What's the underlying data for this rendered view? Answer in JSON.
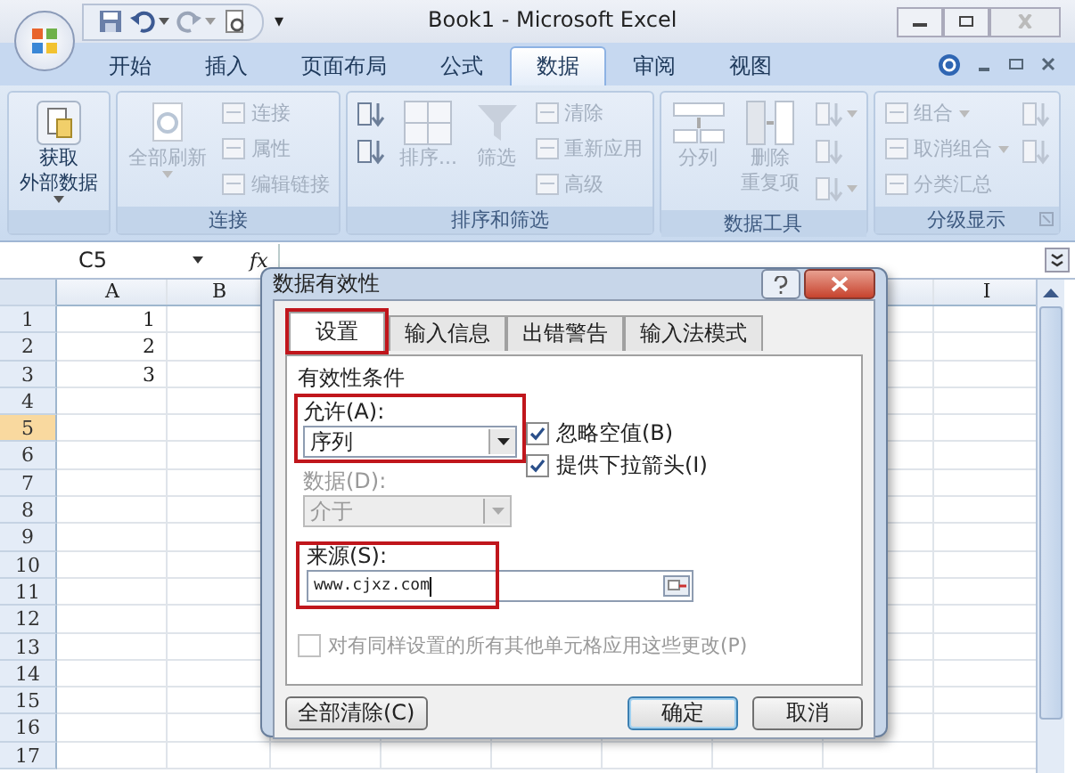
{
  "window": {
    "title": "Book1 - Microsoft Excel",
    "customize_glyph": "▾"
  },
  "ribbon_tabs": [
    {
      "label": "开始",
      "selected": false
    },
    {
      "label": "插入",
      "selected": false
    },
    {
      "label": "页面布局",
      "selected": false
    },
    {
      "label": "公式",
      "selected": false
    },
    {
      "label": "数据",
      "selected": true
    },
    {
      "label": "审阅",
      "selected": false
    },
    {
      "label": "视图",
      "selected": false
    }
  ],
  "ribbon_groups": [
    {
      "columns": [
        [
          {
            "kind": "large",
            "lines": [
              "获取",
              "外部数据"
            ],
            "dropdown": true,
            "disabled": false
          }
        ]
      ]
    },
    {
      "label": "连接",
      "columns": [
        [
          {
            "kind": "large",
            "lines": [
              "全部刷新"
            ],
            "dropdown": true,
            "disabled": true
          }
        ],
        [
          {
            "kind": "small",
            "label": "连接",
            "disabled": true
          },
          {
            "kind": "small",
            "label": "属性",
            "disabled": true
          },
          {
            "kind": "small",
            "label": "编辑链接",
            "disabled": true
          }
        ]
      ]
    },
    {
      "label": "排序和筛选",
      "columns": [
        [
          {
            "kind": "icon",
            "disabled": false
          },
          {
            "kind": "icon",
            "disabled": false
          }
        ],
        [
          {
            "kind": "large",
            "lines": [
              "排序..."
            ],
            "disabled": true
          }
        ],
        [
          {
            "kind": "large",
            "lines": [
              "筛选"
            ],
            "disabled": true
          }
        ],
        [
          {
            "kind": "small",
            "label": "清除",
            "disabled": true
          },
          {
            "kind": "small",
            "label": "重新应用",
            "disabled": true
          },
          {
            "kind": "small",
            "label": "高级",
            "disabled": true
          }
        ]
      ]
    },
    {
      "label": "数据工具",
      "columns": [
        [
          {
            "kind": "large",
            "lines": [
              "分列"
            ],
            "disabled": true
          }
        ],
        [
          {
            "kind": "large",
            "lines": [
              "删除",
              "重复项"
            ],
            "disabled": true
          }
        ],
        [
          {
            "kind": "icon",
            "dropdown": true,
            "disabled": true
          },
          {
            "kind": "icon",
            "disabled": true
          },
          {
            "kind": "icon",
            "dropdown": true,
            "disabled": true
          }
        ]
      ]
    },
    {
      "label": "分级显示",
      "launcher": true,
      "columns": [
        [
          {
            "kind": "small",
            "label": "组合",
            "dropdown": true,
            "disabled": true
          },
          {
            "kind": "small",
            "label": "取消组合",
            "dropdown": true,
            "disabled": true
          },
          {
            "kind": "small",
            "label": "分类汇总",
            "disabled": true
          }
        ],
        [
          {
            "kind": "icon",
            "disabled": true
          },
          {
            "kind": "icon",
            "disabled": true
          }
        ]
      ]
    }
  ],
  "formula_bar": {
    "name_box": "C5",
    "function_label": "fx"
  },
  "sheet": {
    "columns": [
      "A",
      "B",
      "I"
    ],
    "rows": [
      {
        "label": "1",
        "selected": false,
        "a": "1"
      },
      {
        "label": "2",
        "selected": false,
        "a": "2"
      },
      {
        "label": "3",
        "selected": false,
        "a": "3"
      },
      {
        "label": "4",
        "selected": false
      },
      {
        "label": "5",
        "selected": true
      },
      {
        "label": "6",
        "selected": false
      },
      {
        "label": "7",
        "selected": false
      },
      {
        "label": "8",
        "selected": false
      },
      {
        "label": "9",
        "selected": false
      },
      {
        "label": "10",
        "selected": false
      },
      {
        "label": "11",
        "selected": false
      },
      {
        "label": "12",
        "selected": false
      },
      {
        "label": "13",
        "selected": false
      },
      {
        "label": "14",
        "selected": false
      },
      {
        "label": "15",
        "selected": false
      },
      {
        "label": "16",
        "selected": false
      },
      {
        "label": "17",
        "selected": false
      }
    ]
  },
  "dialog": {
    "title": "数据有效性",
    "tabs": [
      {
        "label": "设置",
        "selected": true,
        "highlighted": true
      },
      {
        "label": "输入信息",
        "selected": false,
        "highlighted": false
      },
      {
        "label": "出错警告",
        "selected": false,
        "highlighted": false
      },
      {
        "label": "输入法模式",
        "selected": false,
        "highlighted": false
      }
    ],
    "group_label": "有效性条件",
    "allow": {
      "label": "允许(A):",
      "value": "序列",
      "highlighted": true
    },
    "checkboxes": [
      {
        "label": "忽略空值(B)",
        "checked": true
      },
      {
        "label": "提供下拉箭头(I)",
        "checked": true
      }
    ],
    "data": {
      "label": "数据(D):",
      "value": "介于",
      "disabled": true
    },
    "source": {
      "label": "来源(S):",
      "value": "www.cjxz.com",
      "highlighted": true
    },
    "apply_all": {
      "label": "对有同样设置的所有其他单元格应用这些更改(P)",
      "checked": false,
      "disabled": true
    },
    "buttons": [
      {
        "label": "全部清除(C)",
        "default": false
      },
      {
        "label": "确定",
        "default": true
      },
      {
        "label": "取消",
        "default": false
      }
    ]
  }
}
